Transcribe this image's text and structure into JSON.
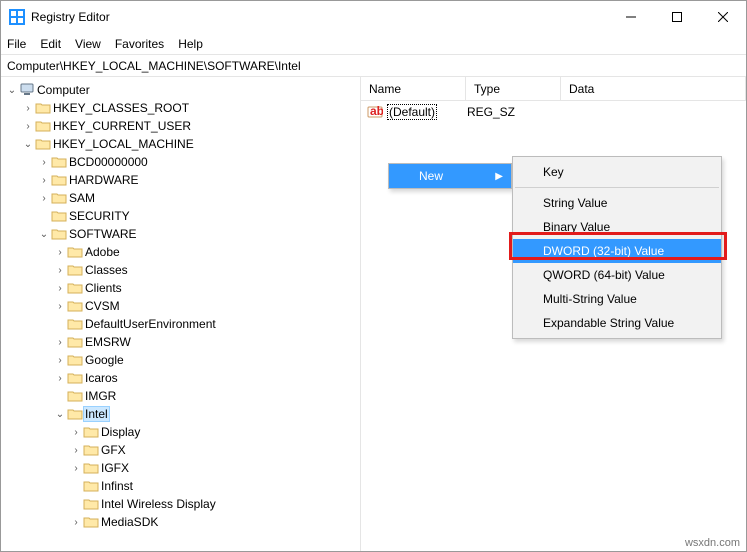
{
  "window": {
    "title": "Registry Editor"
  },
  "menu": {
    "file": "File",
    "edit": "Edit",
    "view": "View",
    "favorites": "Favorites",
    "help": "Help"
  },
  "address": {
    "path": "Computer\\HKEY_LOCAL_MACHINE\\SOFTWARE\\Intel"
  },
  "list": {
    "cols": {
      "name": "Name",
      "type": "Type",
      "data": "Data"
    },
    "rows": [
      {
        "name": "(Default)",
        "type": "REG_SZ",
        "data": ""
      }
    ]
  },
  "context": {
    "new": "New",
    "items": {
      "key": "Key",
      "string": "String Value",
      "binary": "Binary Value",
      "dword": "DWORD (32-bit) Value",
      "qword": "QWORD (64-bit) Value",
      "multi": "Multi-String Value",
      "expand": "Expandable String Value"
    }
  },
  "tree": {
    "root": "Computer",
    "hkcr": "HKEY_CLASSES_ROOT",
    "hkcu": "HKEY_CURRENT_USER",
    "hklm": "HKEY_LOCAL_MACHINE",
    "bcd": "BCD00000000",
    "hw": "HARDWARE",
    "sam": "SAM",
    "sec": "SECURITY",
    "sw": "SOFTWARE",
    "adobe": "Adobe",
    "classes": "Classes",
    "clients": "Clients",
    "cvsm": "CVSM",
    "due": "DefaultUserEnvironment",
    "emsrw": "EMSRW",
    "google": "Google",
    "icaros": "Icaros",
    "imgr": "IMGR",
    "intel": "Intel",
    "display": "Display",
    "gfx": "GFX",
    "igfx": "IGFX",
    "infinst": "Infinst",
    "iwd": "Intel Wireless Display",
    "mediasdk": "MediaSDK"
  },
  "watermark": "wsxdn.com"
}
